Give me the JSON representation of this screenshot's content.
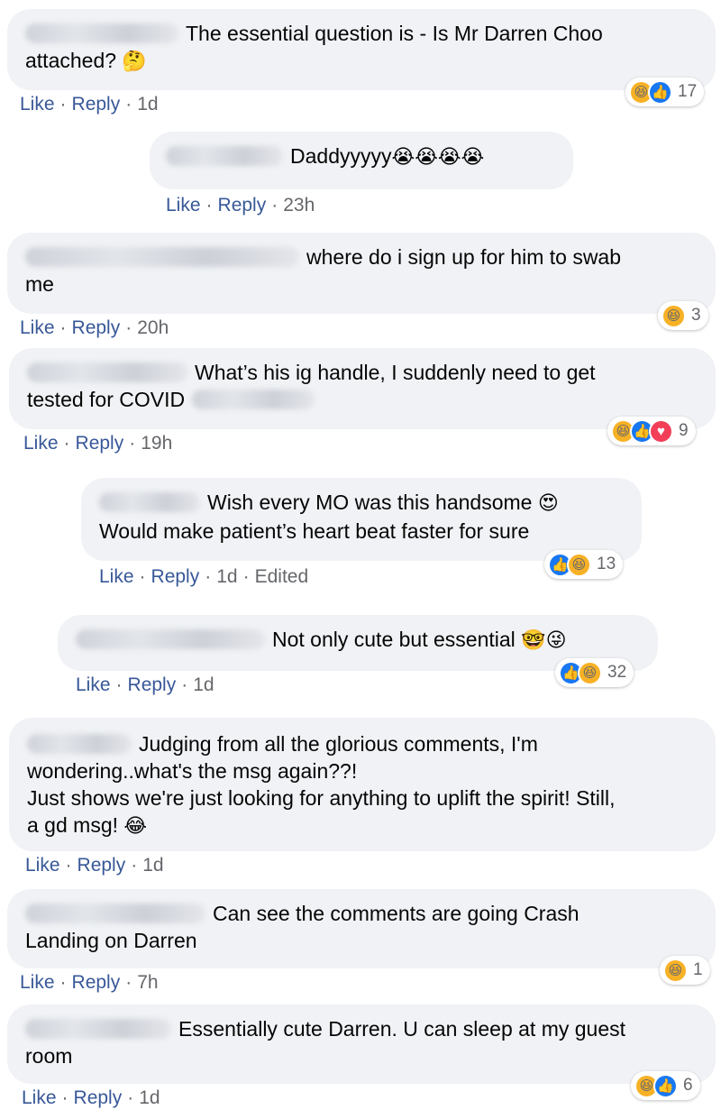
{
  "comments": [
    {
      "text_line1": "The essential question is - Is Mr Darren Choo",
      "text_line2": "attached?",
      "emoji": "🤔",
      "actions": {
        "like": "Like",
        "reply": "Reply",
        "time": "1d"
      },
      "reactions": {
        "types": [
          "haha",
          "like"
        ],
        "count": "17"
      }
    },
    {
      "text_line1": "Daddyyyyy",
      "emoji": "😭😭😭😭",
      "actions": {
        "like": "Like",
        "reply": "Reply",
        "time": "23h"
      }
    },
    {
      "text_line1": "where do i sign up for him to swab",
      "text_line2": "me",
      "actions": {
        "like": "Like",
        "reply": "Reply",
        "time": "20h"
      },
      "reactions": {
        "types": [
          "haha"
        ],
        "count": "3"
      }
    },
    {
      "text_line1": "What’s his ig handle, I suddenly need to get",
      "text_line2": "tested for COVID",
      "actions": {
        "like": "Like",
        "reply": "Reply",
        "time": "19h"
      },
      "reactions": {
        "types": [
          "haha",
          "like",
          "love"
        ],
        "count": "9"
      }
    },
    {
      "text_line1": "Wish every MO was this handsome",
      "emoji": "😍",
      "text_line2": "Would make patient’s heart beat faster for sure",
      "actions": {
        "like": "Like",
        "reply": "Reply",
        "time": "1d",
        "edited": "Edited"
      },
      "reactions": {
        "types": [
          "like",
          "haha"
        ],
        "count": "13"
      }
    },
    {
      "text_line1": "Not only cute but essential",
      "emoji": "🤓😜",
      "actions": {
        "like": "Like",
        "reply": "Reply",
        "time": "1d"
      },
      "reactions": {
        "types": [
          "like",
          "haha"
        ],
        "count": "32"
      }
    },
    {
      "text_line1": "Judging from all the glorious comments, I'm",
      "text_line2": "wondering..what's the msg again??!",
      "text_line3": "Just shows we're just looking for anything to uplift the spirit! Still,",
      "text_line4": "a gd msg!",
      "emoji": "😂",
      "actions": {
        "like": "Like",
        "reply": "Reply",
        "time": "1d"
      }
    },
    {
      "text_line1": "Can see the comments are going Crash",
      "text_line2": "Landing on Darren",
      "actions": {
        "like": "Like",
        "reply": "Reply",
        "time": "7h"
      },
      "reactions": {
        "types": [
          "haha"
        ],
        "count": "1"
      }
    },
    {
      "text_line1": "Essentially cute Darren. U can sleep at my guest",
      "text_line2": "room",
      "actions": {
        "like": "Like",
        "reply": "Reply",
        "time": "1d"
      },
      "reactions": {
        "types": [
          "haha",
          "like"
        ],
        "count": "6"
      }
    }
  ],
  "reaction_icons": {
    "haha": "😆",
    "like": "👍",
    "love": "♥",
    "wow": "😮"
  },
  "separator": "·"
}
